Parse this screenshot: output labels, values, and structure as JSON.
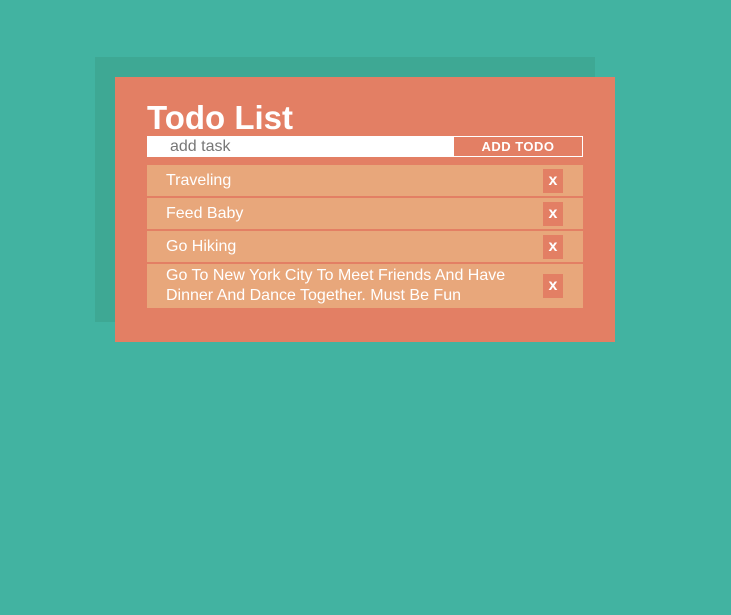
{
  "app": {
    "title": "Todo List"
  },
  "form": {
    "input_placeholder": "add task",
    "input_value": "",
    "add_label": "ADD TODO"
  },
  "todos": [
    {
      "text": "Traveling",
      "delete_label": "x"
    },
    {
      "text": "Feed Baby",
      "delete_label": "x"
    },
    {
      "text": "Go Hiking",
      "delete_label": "x"
    },
    {
      "text": "Go To New York City To Meet Friends And Have Dinner And Dance Together. Must Be Fun",
      "delete_label": "x"
    }
  ],
  "colors": {
    "background": "#42b3a1",
    "card": "#e37f64",
    "item": "#e8a77b",
    "text": "#ffffff"
  }
}
